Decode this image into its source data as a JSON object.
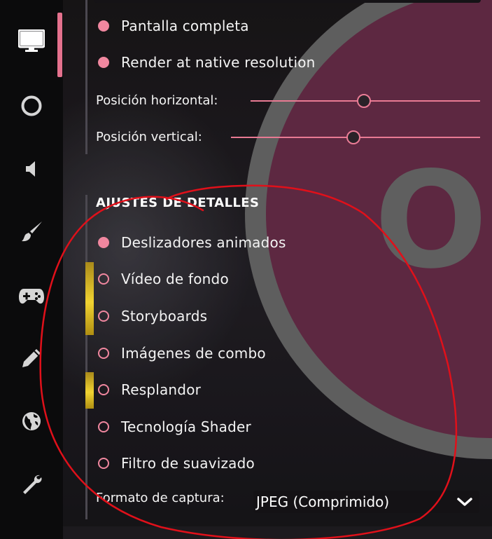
{
  "colors": {
    "accent": "#f0879f",
    "highlight_gold": "#f1d331",
    "logo_fill": "#6a2e4a",
    "annotation_red": "#e0101a"
  },
  "sidebar": {
    "items": [
      {
        "name": "display",
        "icon": "monitor-icon",
        "active": true
      },
      {
        "name": "circle",
        "icon": "circle-icon",
        "active": false
      },
      {
        "name": "audio",
        "icon": "speaker-icon",
        "active": false
      },
      {
        "name": "skin",
        "icon": "paintbrush-icon",
        "active": false
      },
      {
        "name": "input",
        "icon": "gamepad-icon",
        "active": false
      },
      {
        "name": "editor",
        "icon": "pencil-icon",
        "active": false
      },
      {
        "name": "online",
        "icon": "globe-icon",
        "active": false
      },
      {
        "name": "maintenance",
        "icon": "wrench-icon",
        "active": false
      }
    ]
  },
  "background": {
    "logo_text": "OS"
  },
  "display": {
    "fullscreen": {
      "label": "Pantalla completa",
      "checked": true
    },
    "native_resolution": {
      "label": "Render at native resolution",
      "checked": true
    },
    "horizontal_position": {
      "label": "Posición horizontal:",
      "value": 0.49
    },
    "vertical_position": {
      "label": "Posición vertical:",
      "value": 0.49
    }
  },
  "detail_settings": {
    "title": "AJUSTES DE DETALLES",
    "options": [
      {
        "label": "Deslizadores animados",
        "checked": true,
        "highlighted": false
      },
      {
        "label": "Vídeo de fondo",
        "checked": false,
        "highlighted": true
      },
      {
        "label": "Storyboards",
        "checked": false,
        "highlighted": true
      },
      {
        "label": "Imágenes de combo",
        "checked": false,
        "highlighted": false
      },
      {
        "label": "Resplandor",
        "checked": false,
        "highlighted": true
      },
      {
        "label": "Tecnología Shader",
        "checked": false,
        "highlighted": false
      },
      {
        "label": "Filtro de suavizado",
        "checked": false,
        "highlighted": false
      }
    ],
    "screenshot_format": {
      "label": "Formato de captura:",
      "value": "JPEG (Comprimido)"
    }
  }
}
